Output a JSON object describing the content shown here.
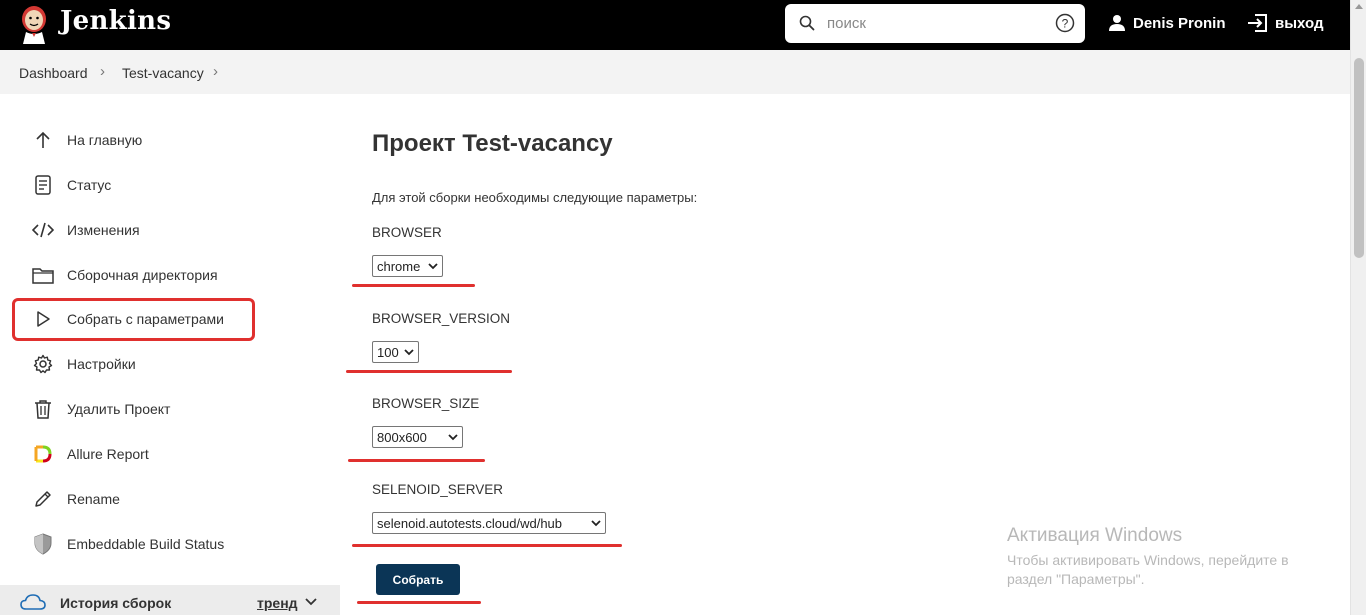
{
  "header": {
    "title": "Jenkins",
    "search_placeholder": "поиск",
    "user_name": "Denis Pronin",
    "logout_label": "выход"
  },
  "breadcrumb": [
    "Dashboard",
    "Test-vacancy"
  ],
  "sidebar": {
    "items": [
      {
        "label": "На главную",
        "icon": "arrow-up-icon"
      },
      {
        "label": "Статус",
        "icon": "document-icon"
      },
      {
        "label": "Изменения",
        "icon": "code-icon"
      },
      {
        "label": "Сборочная директория",
        "icon": "folder-icon"
      },
      {
        "label": "Собрать с параметрами",
        "icon": "play-icon"
      },
      {
        "label": "Настройки",
        "icon": "gear-icon"
      },
      {
        "label": "Удалить Проект",
        "icon": "trash-icon"
      },
      {
        "label": "Allure Report",
        "icon": "allure-icon"
      },
      {
        "label": "Rename",
        "icon": "pencil-icon"
      },
      {
        "label": "Embeddable Build Status",
        "icon": "shield-icon"
      }
    ],
    "history_label": "История сборок",
    "trend_label": "тренд"
  },
  "main": {
    "title": "Проект Test-vacancy",
    "intro": "Для этой сборки необходимы следующие параметры:",
    "params": [
      {
        "name": "BROWSER",
        "value": "chrome"
      },
      {
        "name": "BROWSER_VERSION",
        "value": "100"
      },
      {
        "name": "BROWSER_SIZE",
        "value": "800x600"
      },
      {
        "name": "SELENOID_SERVER",
        "value": "selenoid.autotests.cloud/wd/hub"
      }
    ],
    "build_button": "Собрать"
  },
  "watermark": {
    "title": "Активация Windows",
    "line1": "Чтобы активировать Windows, перейдите в",
    "line2": "раздел \"Параметры\"."
  },
  "colors": {
    "header_bg": "#000000",
    "annotation_red": "#e0302e",
    "button_bg": "#0b3556"
  }
}
